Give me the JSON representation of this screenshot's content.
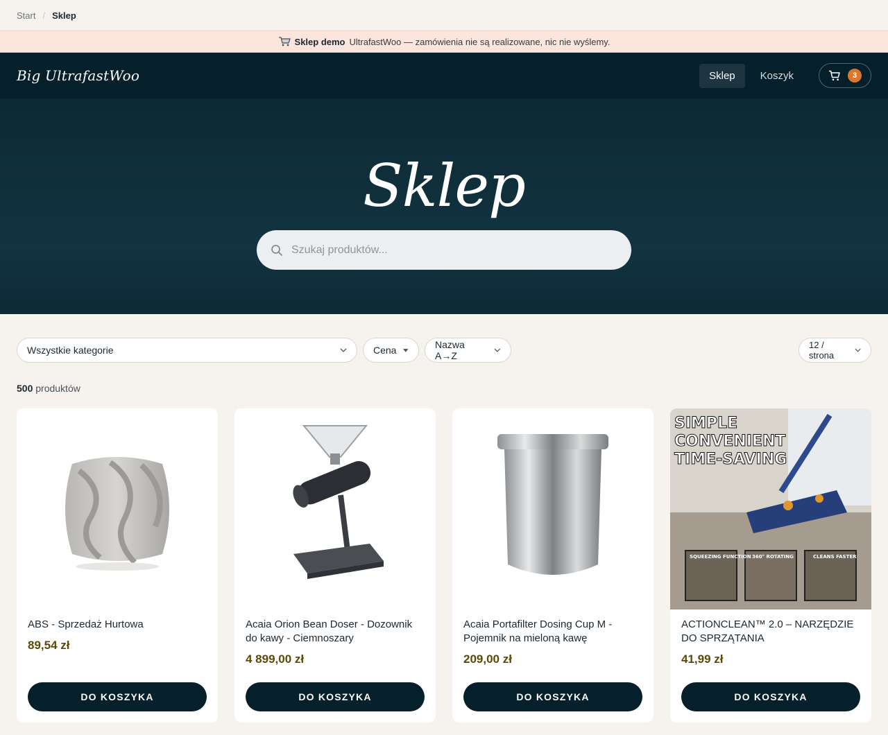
{
  "breadcrumb": {
    "start": "Start",
    "current": "Sklep"
  },
  "banner": {
    "strong": "Sklep demo",
    "text": "UltrafastWoo — zamówienia nie są realizowane, nic nie wyślemy."
  },
  "nav": {
    "logo": "Big UltrafastWoo",
    "links": [
      "Sklep",
      "Koszyk"
    ],
    "cart_count": "3"
  },
  "hero": {
    "title": "Sklep",
    "search_placeholder": "Szukaj produktów..."
  },
  "filters": {
    "category": "Wszystkie kategorie",
    "price": "Cena",
    "sort": "Nazwa A→Z",
    "per_page": "12 / strona"
  },
  "results": {
    "count": "500",
    "label": "produktów"
  },
  "products": [
    {
      "name": "ABS - Sprzedaż Hurtowa",
      "price": "89,54 zł",
      "button": "DO KOSZYKA"
    },
    {
      "name": "Acaia Orion Bean Doser - Dozownik do kawy - Ciemnoszary",
      "price": "4 899,00 zł",
      "button": "DO KOSZYKA"
    },
    {
      "name": "Acaia Portafilter Dosing Cup M - Pojemnik na mieloną kawę",
      "price": "209,00 zł",
      "button": "DO KOSZYKA"
    },
    {
      "name": "ACTIONCLEAN™ 2.0 – NARZĘDZIE DO SPRZĄTANIA",
      "price": "41,99 zł",
      "button": "DO KOSZYKA",
      "image_text": [
        "SIMPLE",
        "CONVENIENT",
        "TIME-SAVING"
      ],
      "image_captions": [
        "SQUEEZING FUNCTION",
        "360° ROTATING",
        "CLEANS FASTER"
      ]
    }
  ],
  "colors": {
    "nav_bg": "#05202b",
    "accent": "#d9782c",
    "price": "#5a4a05",
    "banner_bg": "#fbe5dd"
  }
}
